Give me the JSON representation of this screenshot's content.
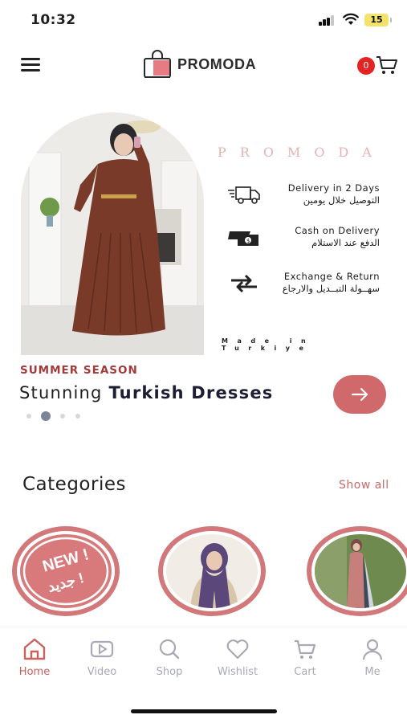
{
  "status_bar": {
    "time": "10:32",
    "battery": "15"
  },
  "header": {
    "brand": "PROMODA",
    "cart_count": "0"
  },
  "hero": {
    "spaced_brand": "PROMODA",
    "features": [
      {
        "icon": "delivery-truck-icon",
        "en": "Delivery in 2 Days",
        "ar": "التوصيل خلال يومين"
      },
      {
        "icon": "cash-icon",
        "en": "Cash on Delivery",
        "ar": "الدفع عند الاستلام"
      },
      {
        "icon": "exchange-arrows-icon",
        "en": "Exchange & Return",
        "ar": "سهــولة التبــديل والارجاع"
      }
    ],
    "made_in": "Made in Turkiye",
    "season": "SUMMER SEASON",
    "headline_regular": "Stunning ",
    "headline_bold": "Turkish Dresses",
    "dots_count": 4,
    "active_dot": 1
  },
  "categories": {
    "title": "Categories",
    "show_all": "Show all",
    "new_badge_en": "NEW !",
    "new_badge_ar": "جديد !"
  },
  "bottom_nav": [
    {
      "label": "Home",
      "icon": "home-icon",
      "active": true
    },
    {
      "label": "Video",
      "icon": "video-icon",
      "active": false
    },
    {
      "label": "Shop",
      "icon": "search-icon",
      "active": false
    },
    {
      "label": "Wishlist",
      "icon": "heart-icon",
      "active": false
    },
    {
      "label": "Cart",
      "icon": "cart-icon",
      "active": false
    },
    {
      "label": "Me",
      "icon": "user-icon",
      "active": false
    }
  ],
  "colors": {
    "accent": "#d0696b",
    "accent_dark": "#a33a3a",
    "nav_inactive": "#a9a9b4",
    "badge": "#e52323"
  }
}
